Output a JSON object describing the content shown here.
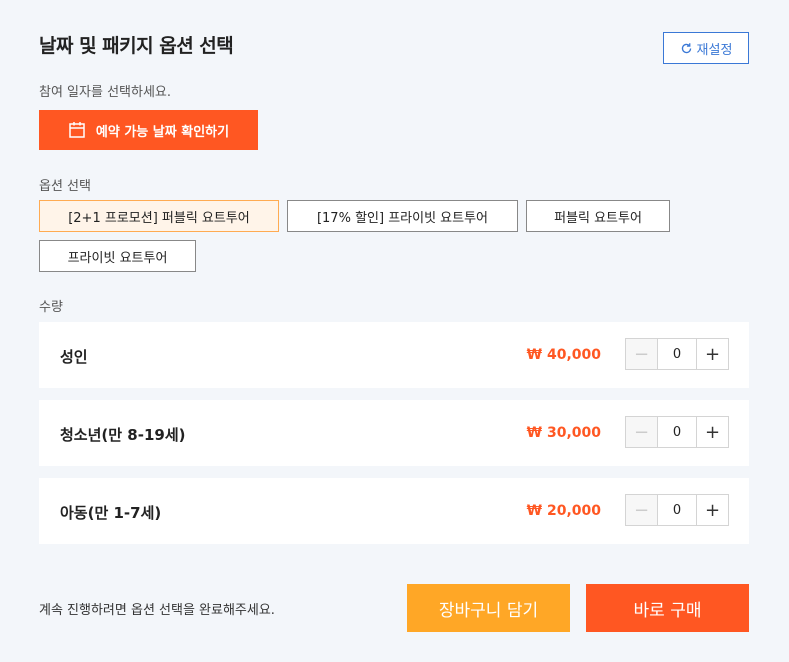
{
  "header": {
    "title": "날짜 및 패키지 옵션 선택",
    "reset_label": "재설정"
  },
  "date": {
    "prompt": "참여 일자를 선택하세요.",
    "button_label": "예약 가능 날짜 확인하기"
  },
  "options": {
    "label": "옵션 선택",
    "items": [
      {
        "label": "[2+1 프로모션] 퍼블릭 요트투어",
        "selected": true
      },
      {
        "label": "[17% 할인] 프라이빗 요트투어",
        "selected": false
      },
      {
        "label": "퍼블릭 요트투어",
        "selected": false
      },
      {
        "label": "프라이빗 요트투어",
        "selected": false
      }
    ]
  },
  "quantity": {
    "label": "수량",
    "rows": [
      {
        "label": "성인",
        "price": "₩ 40,000",
        "value": "0"
      },
      {
        "label": "청소년(만 8-19세)",
        "price": "₩ 30,000",
        "value": "0"
      },
      {
        "label": "아동(만 1-7세)",
        "price": "₩ 20,000",
        "value": "0"
      }
    ],
    "minus_symbol": "−",
    "plus_symbol": "+"
  },
  "footer": {
    "message": "계속 진행하려면 옵션 선택을 완료해주세요.",
    "cart_label": "장바구니 담기",
    "buy_label": "바로 구매"
  },
  "colors": {
    "accent": "#ff5722",
    "cart": "#ffa726",
    "link": "#3a78d6",
    "selected_bg": "#fff4e9",
    "selected_border": "#ffab52"
  }
}
